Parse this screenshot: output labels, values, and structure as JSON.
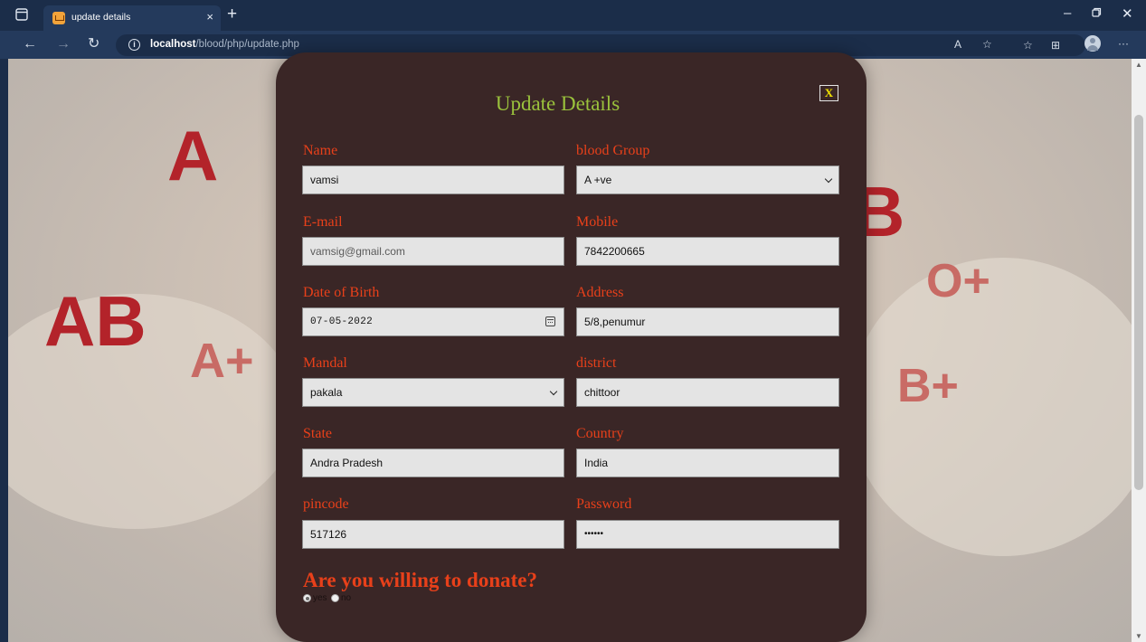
{
  "browser": {
    "tab_title": "update details",
    "tab_close": "×",
    "new_tab": "+",
    "url_host": "localhost",
    "url_path": "/blood/php/update.php",
    "icons": [
      "sidebar-icon",
      "favicon",
      "back-icon",
      "forward-icon",
      "refresh-icon",
      "info-icon",
      "read-aloud-icon",
      "favorite-add-icon",
      "favorites-icon",
      "collections-icon",
      "profile-icon",
      "more-icon",
      "minimize-icon",
      "restore-icon",
      "close-window-icon"
    ]
  },
  "background": {
    "letters": [
      "A",
      "AB",
      "A+",
      "B",
      "O+",
      "B+"
    ]
  },
  "form": {
    "title": "Update Details",
    "close_label": "X",
    "fields": {
      "name": {
        "label": "Name",
        "value": "vamsi"
      },
      "blood_group": {
        "label": "blood Group",
        "value": "A +ve"
      },
      "email": {
        "label": "E-mail",
        "value": "vamsig@gmail.com"
      },
      "mobile": {
        "label": "Mobile",
        "value": "7842200665"
      },
      "dob": {
        "label": "Date of Birth",
        "value": "07-05-2022"
      },
      "address": {
        "label": "Address",
        "value": "5/8,penumur"
      },
      "mandal": {
        "label": "Mandal",
        "value": "pakala"
      },
      "district": {
        "label": "district",
        "value": "chittoor"
      },
      "state": {
        "label": "State",
        "value": "Andra Pradesh"
      },
      "country": {
        "label": "Country",
        "value": "India"
      },
      "pincode": {
        "label": "pincode",
        "value": "517126"
      },
      "password": {
        "label": "Password",
        "value": "••••••"
      }
    },
    "donate_question": "Are you willing to donate?",
    "donate_options": [
      {
        "label": "yes",
        "checked": true
      },
      {
        "label": "no",
        "checked": false
      }
    ]
  },
  "colors": {
    "title": "#9ac23c",
    "label": "#e8401a",
    "modal_bg": "#3a2626",
    "chrome": "#1b2d49"
  }
}
